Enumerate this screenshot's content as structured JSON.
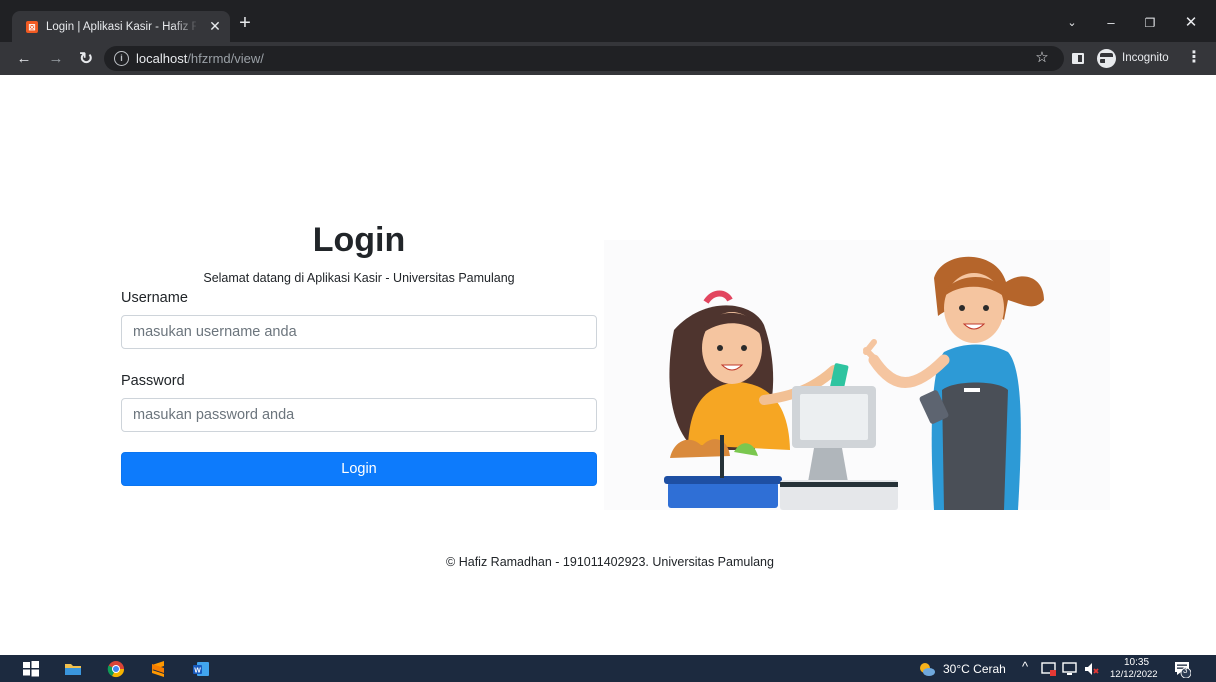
{
  "browser": {
    "tab_title": "Login | Aplikasi Kasir - Hafiz Ramadhan",
    "url_host": "localhost",
    "url_path": "/hfzrmd/view/",
    "incognito_label": "Incognito",
    "icons": [
      "xampp-favicon",
      "close-icon",
      "plus-icon",
      "chevron-down-icon",
      "minimize-icon",
      "restore-icon",
      "close-window-icon",
      "back-arrow-icon",
      "forward-arrow-icon",
      "reload-icon",
      "info-icon",
      "star-icon",
      "side-panel-icon",
      "incognito-icon",
      "kebab-menu-icon"
    ]
  },
  "login": {
    "title": "Login",
    "subtitle": "Selamat datang di Aplikasi Kasir - Universitas Pamulang",
    "username_label": "Username",
    "username_placeholder": "masukan username anda",
    "password_label": "Password",
    "password_placeholder": "masukan password anda",
    "button_label": "Login",
    "accent_color": "#0d7bfc"
  },
  "footer": {
    "text": "© Hafiz Ramadhan - 191011402923. Universitas Pamulang"
  },
  "taskbar": {
    "weather": "30°C  Cerah",
    "time": "10:35",
    "date": "12/12/2022",
    "notification_count": "3",
    "background_color": "#1c2a3f"
  }
}
